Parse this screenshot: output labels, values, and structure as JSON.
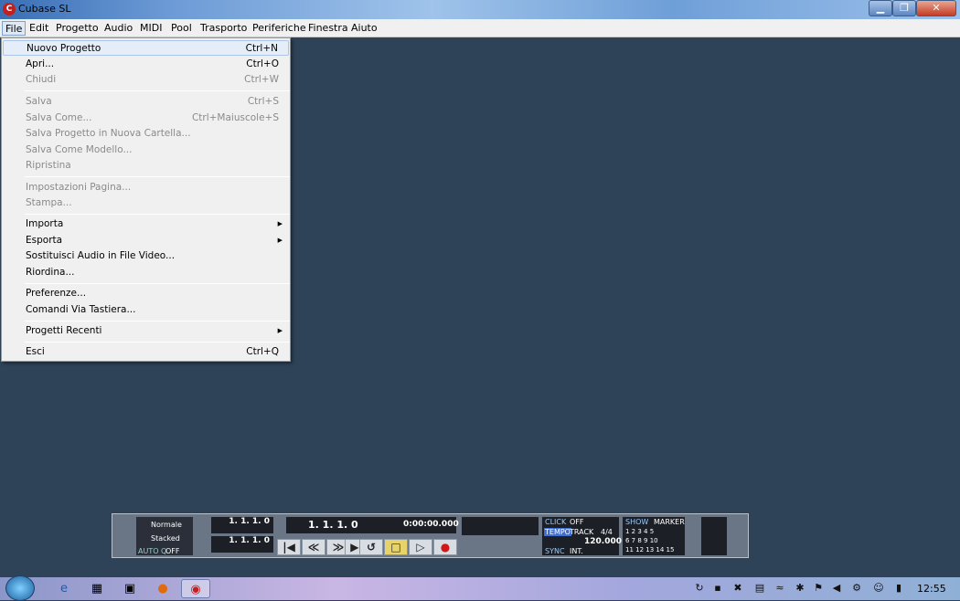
{
  "window": {
    "title": "Cubase SL",
    "app_icon": "cubase-logo-icon",
    "minimize": "▁",
    "maximize": "❐",
    "close": "✕"
  },
  "menu": [
    "File",
    "Edit",
    "Progetto",
    "Audio",
    "MIDI",
    "Pool",
    "Trasporto",
    "Periferiche",
    "Finestra",
    "Aiuto"
  ],
  "file_menu": [
    {
      "label": "Nuovo Progetto",
      "shortcut": "Ctrl+N"
    },
    {
      "label": "Apri...",
      "shortcut": "Ctrl+O"
    },
    {
      "label": "Chiudi",
      "shortcut": "Ctrl+W"
    },
    {
      "label": "Salva",
      "shortcut": "Ctrl+S"
    },
    {
      "label": "Salva Come...",
      "shortcut": "Ctrl+Maiuscole+S"
    },
    {
      "label": "Salva Progetto in Nuova Cartella...",
      "shortcut": ""
    },
    {
      "label": "Salva Come Modello...",
      "shortcut": ""
    },
    {
      "label": "Ripristina",
      "shortcut": ""
    },
    {
      "label": "Impostazioni Pagina...",
      "shortcut": ""
    },
    {
      "label": "Stampa...",
      "shortcut": ""
    },
    {
      "label": "Importa",
      "shortcut": ""
    },
    {
      "label": "Esporta",
      "shortcut": ""
    },
    {
      "label": "Sostituisci Audio in File Video...",
      "shortcut": ""
    },
    {
      "label": "Riordina...",
      "shortcut": ""
    },
    {
      "label": "Preferenze...",
      "shortcut": ""
    },
    {
      "label": "Comandi Via Tastiera...",
      "shortcut": ""
    },
    {
      "label": "Progetti Recenti",
      "shortcut": ""
    },
    {
      "label": "Esci",
      "shortcut": "Ctrl+Q"
    }
  ],
  "transport": {
    "mode1": "Normale",
    "mode2": "Stacked",
    "auto": "AUTO Q",
    "auto_val": "OFF",
    "left_loc": "1. 1. 1.   0",
    "right_loc": "1. 1. 1.   0",
    "position": "1. 1. 1.   0",
    "time": "0:00:00.000",
    "click": "CLICK",
    "click_val": "OFF",
    "tempo": "TEMPO",
    "track": "TRACK",
    "signature": "4/4",
    "bpm": "120.000",
    "sync": "SYNC",
    "sync_val": "INT.",
    "show": "SHOW",
    "marker": "MARKER",
    "markers": "1 2 3 4 5\n6 7 8 9 10\n11 12 13 14 15"
  },
  "taskbar": {
    "clock": "12:55"
  }
}
